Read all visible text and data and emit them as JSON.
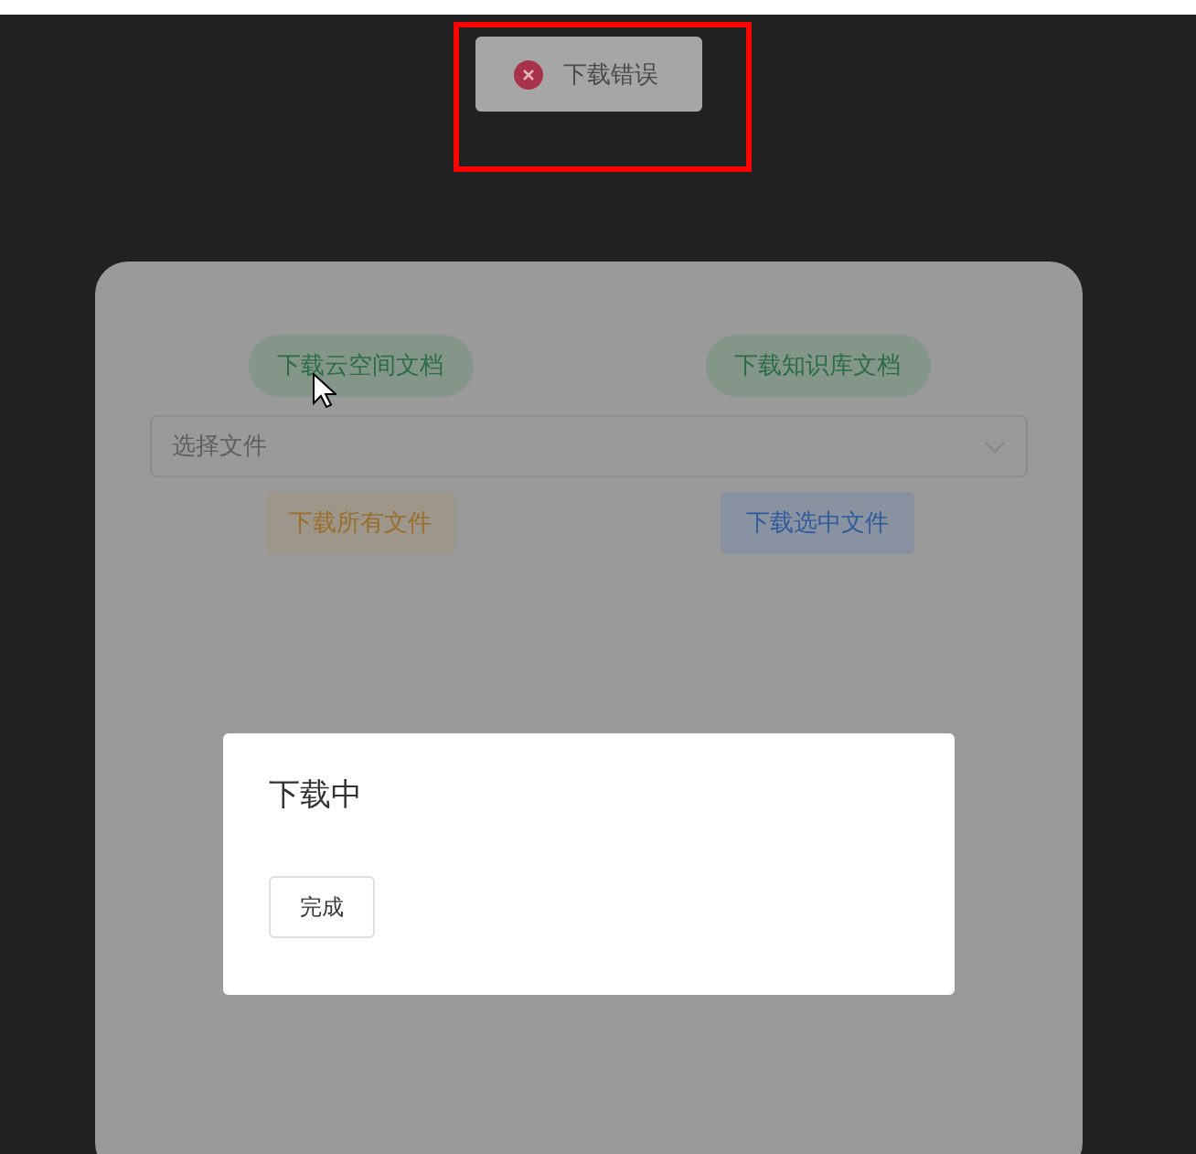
{
  "toast": {
    "kind": "error",
    "text": "下载错误",
    "highlighted": true
  },
  "top_buttons": [
    {
      "label": "下载云空间文档",
      "kind": "success-round"
    },
    {
      "label": "下载知识库文档",
      "kind": "success-round"
    }
  ],
  "file_select": {
    "placeholder": "选择文件"
  },
  "bottom_buttons": [
    {
      "label": "下载所有文件",
      "kind": "warning"
    },
    {
      "label": "下载选中文件",
      "kind": "primary"
    }
  ],
  "dialog": {
    "title": "下载中",
    "button": "完成"
  }
}
